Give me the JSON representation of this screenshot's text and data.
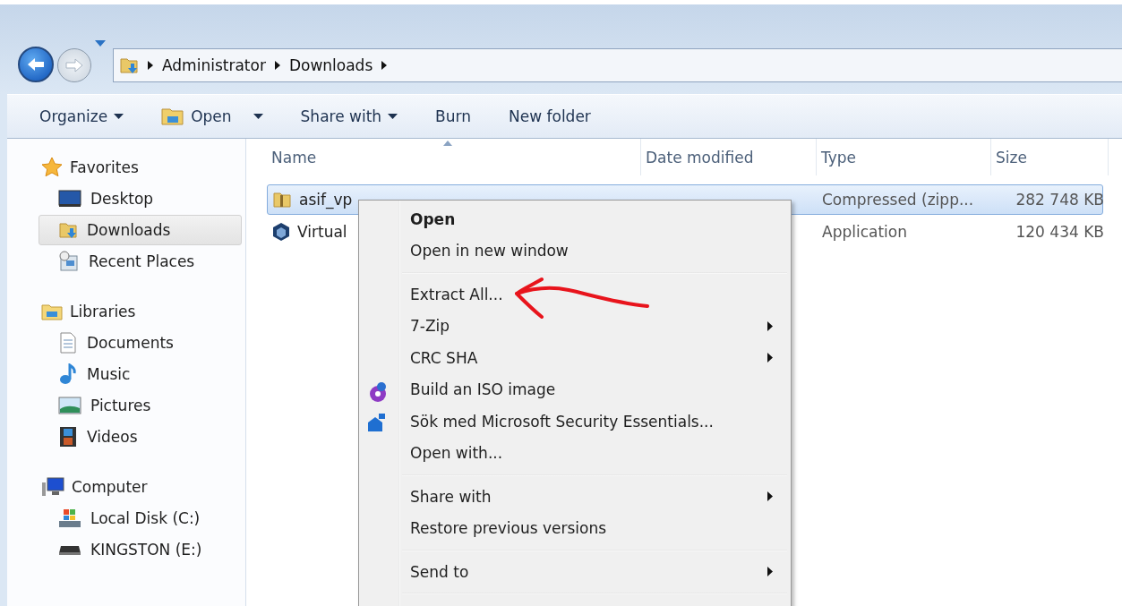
{
  "navigation": {
    "breadcrumbs": [
      "Administrator",
      "Downloads"
    ]
  },
  "toolbar": [
    {
      "label": "Organize",
      "kind": "dropdown"
    },
    {
      "label": "Open",
      "kind": "split"
    },
    {
      "label": "Share with",
      "kind": "dropdown"
    },
    {
      "label": "Burn",
      "kind": "plain"
    },
    {
      "label": "New folder",
      "kind": "plain"
    }
  ],
  "sidebar": {
    "groups": [
      {
        "label": "Favorites",
        "children": [
          {
            "label": "Desktop",
            "selected": false
          },
          {
            "label": "Downloads",
            "selected": true
          },
          {
            "label": "Recent Places",
            "selected": false
          }
        ]
      },
      {
        "label": "Libraries",
        "children": [
          {
            "label": "Documents",
            "selected": false
          },
          {
            "label": "Music",
            "selected": false
          },
          {
            "label": "Pictures",
            "selected": false
          },
          {
            "label": "Videos",
            "selected": false
          }
        ]
      },
      {
        "label": "Computer",
        "children": [
          {
            "label": "Local Disk (C:)",
            "selected": false
          },
          {
            "label": "KINGSTON (E:)",
            "selected": false
          }
        ]
      }
    ]
  },
  "table": {
    "columns": [
      "Name",
      "Date modified",
      "Type",
      "Size"
    ],
    "rows": [
      {
        "name": "asif_vp",
        "type": "Compressed (zipp...",
        "size": "282 748 KB",
        "selected": true
      },
      {
        "name": "Virtual",
        "type": "Application",
        "size": "120 434 KB",
        "selected": false
      }
    ]
  },
  "context_menu": {
    "items": [
      {
        "kind": "item",
        "label": "Open",
        "default": true,
        "submenu": false
      },
      {
        "kind": "item",
        "label": "Open in new window",
        "default": false,
        "submenu": false
      },
      {
        "kind": "separator"
      },
      {
        "kind": "item",
        "label": "Extract All...",
        "default": false,
        "submenu": false
      },
      {
        "kind": "item",
        "label": "7-Zip",
        "default": false,
        "submenu": true
      },
      {
        "kind": "item",
        "label": "CRC SHA",
        "default": false,
        "submenu": true
      },
      {
        "kind": "item",
        "label": "Build an ISO image",
        "default": false,
        "submenu": false
      },
      {
        "kind": "item",
        "label": "Sök med Microsoft Security Essentials...",
        "default": false,
        "submenu": false
      },
      {
        "kind": "item",
        "label": "Open with...",
        "default": false,
        "submenu": false
      },
      {
        "kind": "separator"
      },
      {
        "kind": "item",
        "label": "Share with",
        "default": false,
        "submenu": true
      },
      {
        "kind": "item",
        "label": "Restore previous versions",
        "default": false,
        "submenu": false
      },
      {
        "kind": "separator"
      },
      {
        "kind": "item",
        "label": "Send to",
        "default": false,
        "submenu": true
      },
      {
        "kind": "separator"
      }
    ]
  }
}
